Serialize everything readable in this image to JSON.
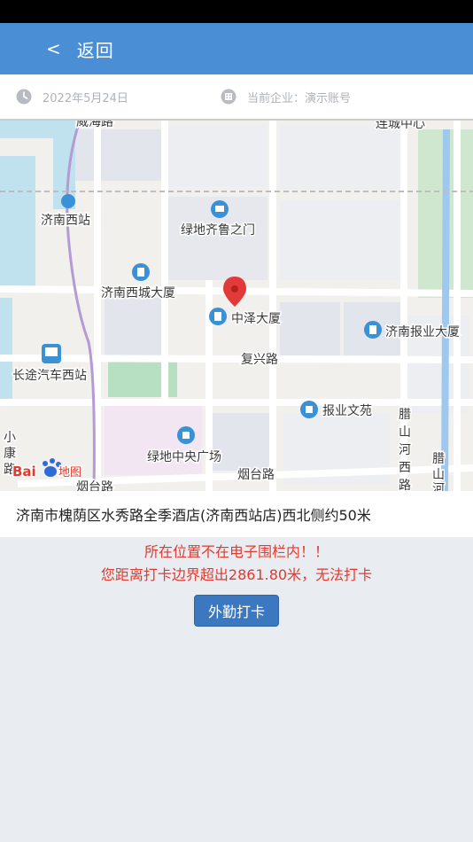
{
  "nav": {
    "back_icon": "chevron-left-icon",
    "back_chevron": "<",
    "back_label": "返回"
  },
  "info": {
    "date": "2022年5月24日",
    "company": "当前企业：演示账号",
    "date_icon": "clock-icon",
    "company_icon": "building-icon"
  },
  "map": {
    "labels": {
      "jinan_west_station": "济南西站",
      "greenland_qilu": "绿地齐鲁之门",
      "jinan_west_tower": "济南西城大厦",
      "zhongze": "中泽大厦",
      "newspaper_tower": "济南报业大厦",
      "fuxing_road": "复兴路",
      "bus_station": "长途汽车西站",
      "newspaper_garden": "报业文苑",
      "greenland_central": "绿地中央广场",
      "yantai_road": "烟台路",
      "xiaokang_road": "小康路",
      "lashan_west": "腊山河西路",
      "lashan_right": "腊山河",
      "top_road": "威海路",
      "top_right": "连城中心",
      "bottom_left_road": "烟台路"
    },
    "logo_text": "Bai地图",
    "marker_icon": "location-pin-icon"
  },
  "address": "济南市槐荫区水秀路全季酒店(济南西站店)西北侧约50米",
  "warnings": {
    "line1": "所在位置不在电子围栏内！！",
    "line2": "您距离打卡边界超出2861.80米，无法打卡"
  },
  "checkin_label": "外勤打卡",
  "colors": {
    "nav": "#4a8fd6",
    "button": "#3c78c0",
    "warning": "#e23a2e",
    "background": "#e9ecf0"
  }
}
